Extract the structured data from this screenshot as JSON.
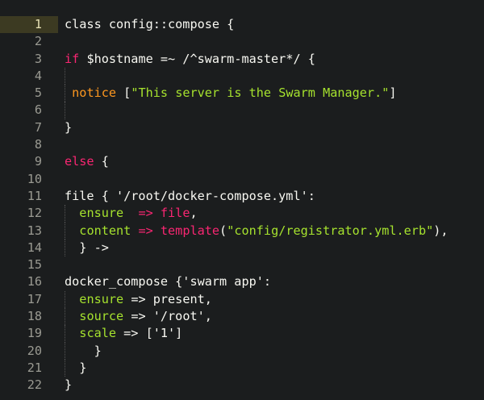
{
  "editor": {
    "lines": [
      {
        "num": "1",
        "current": true,
        "indent": "",
        "tokens": [
          {
            "t": "class config::compose {",
            "c": "plain"
          }
        ]
      },
      {
        "num": "2",
        "indent": "",
        "tokens": []
      },
      {
        "num": "3",
        "indent": "",
        "tokens": [
          {
            "t": "if",
            "c": "kw"
          },
          {
            "t": " $hostname =~ /^swarm-master*/ {",
            "c": "plain"
          }
        ]
      },
      {
        "num": "4",
        "indent": "",
        "guide": true,
        "tokens": []
      },
      {
        "num": "5",
        "indent": " ",
        "guide": true,
        "tokens": [
          {
            "t": "notice",
            "c": "org"
          },
          {
            "t": " [",
            "c": "plain"
          },
          {
            "t": "\"This server is the Swarm Manager.\"",
            "c": "str"
          },
          {
            "t": "]",
            "c": "plain"
          }
        ]
      },
      {
        "num": "6",
        "indent": "",
        "guide": true,
        "tokens": []
      },
      {
        "num": "7",
        "indent": "",
        "tokens": [
          {
            "t": "}",
            "c": "plain"
          }
        ]
      },
      {
        "num": "8",
        "indent": "",
        "tokens": []
      },
      {
        "num": "9",
        "indent": "",
        "tokens": [
          {
            "t": "else",
            "c": "kw"
          },
          {
            "t": " {",
            "c": "plain"
          }
        ]
      },
      {
        "num": "10",
        "indent": "",
        "tokens": []
      },
      {
        "num": "11",
        "indent": "",
        "tokens": [
          {
            "t": "file { '/root/docker-compose.yml':",
            "c": "plain"
          }
        ]
      },
      {
        "num": "12",
        "indent": "  ",
        "guide": true,
        "tokens": [
          {
            "t": "ensure",
            "c": "str"
          },
          {
            "t": "  => ",
            "c": "kw"
          },
          {
            "t": "file",
            "c": "kw"
          },
          {
            "t": ",",
            "c": "plain"
          }
        ]
      },
      {
        "num": "13",
        "indent": "  ",
        "guide": true,
        "tokens": [
          {
            "t": "content",
            "c": "str"
          },
          {
            "t": " => ",
            "c": "kw"
          },
          {
            "t": "template",
            "c": "kw"
          },
          {
            "t": "(",
            "c": "plain"
          },
          {
            "t": "\"config/registrator.yml.erb\"",
            "c": "str"
          },
          {
            "t": "),",
            "c": "plain"
          }
        ]
      },
      {
        "num": "14",
        "indent": "  ",
        "guide": true,
        "tokens": [
          {
            "t": "} ->",
            "c": "plain"
          }
        ]
      },
      {
        "num": "15",
        "indent": "",
        "tokens": []
      },
      {
        "num": "16",
        "indent": "",
        "tokens": [
          {
            "t": "docker_compose {'swarm app':",
            "c": "plain"
          }
        ]
      },
      {
        "num": "17",
        "indent": "  ",
        "guide": true,
        "tokens": [
          {
            "t": "ensure",
            "c": "str"
          },
          {
            "t": " => present,",
            "c": "plain"
          }
        ]
      },
      {
        "num": "18",
        "indent": "  ",
        "guide": true,
        "tokens": [
          {
            "t": "source",
            "c": "str"
          },
          {
            "t": " => '/root',",
            "c": "plain"
          }
        ]
      },
      {
        "num": "19",
        "indent": "  ",
        "guide": true,
        "tokens": [
          {
            "t": "scale",
            "c": "str"
          },
          {
            "t": " => ['1']",
            "c": "plain"
          }
        ]
      },
      {
        "num": "20",
        "indent": "    ",
        "guide": true,
        "tokens": [
          {
            "t": "}",
            "c": "plain"
          }
        ]
      },
      {
        "num": "21",
        "indent": "  ",
        "guide": true,
        "tokens": [
          {
            "t": "}",
            "c": "plain"
          }
        ]
      },
      {
        "num": "22",
        "indent": "",
        "tokens": [
          {
            "t": "}",
            "c": "plain"
          }
        ]
      }
    ]
  },
  "colors": {
    "background": "#1b1d1e",
    "keyword": "#f92672",
    "string": "#a6e22e",
    "notice": "#fd971f",
    "current_line_gutter": "#3c3a22"
  }
}
